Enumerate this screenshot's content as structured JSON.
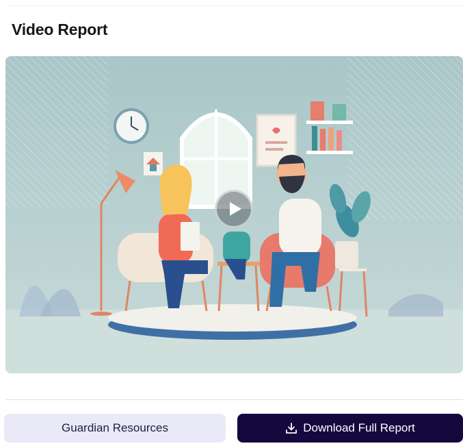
{
  "header": {
    "title": "Video Report"
  },
  "video": {
    "thumbnail_description": "illustration-therapy-session",
    "play_icon": "play-icon",
    "colors": {
      "background": "#b9d0d0",
      "floor": "#dce8e6",
      "platform": "#3e6fa3",
      "accent": "#f07a5c"
    }
  },
  "actions": {
    "guardian_resources_label": "Guardian Resources",
    "download_label": "Download Full Report",
    "download_icon": "download-icon"
  },
  "colors": {
    "primary": "#14083f",
    "secondary": "#e9e9f7",
    "title": "#16161e"
  }
}
